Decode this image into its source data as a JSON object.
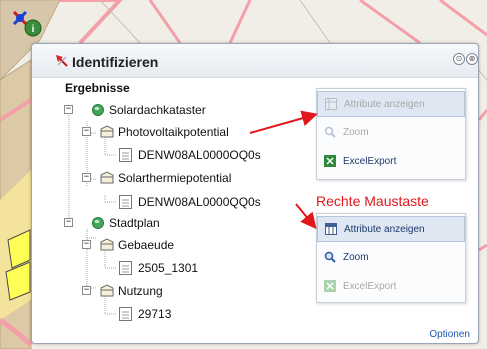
{
  "panel": {
    "title": "Identifizieren",
    "title_icon": "pin-icon",
    "minimize_glyph": "⊙",
    "close_glyph": "⊗",
    "section_label": "Ergebnisse",
    "footer_link": "Optionen"
  },
  "tree": {
    "groups": [
      {
        "label": "Solardachkataster",
        "expander": "−",
        "layers": [
          {
            "label": "Photovoltaikpotential",
            "expander": "−",
            "features": [
              "DENW08AL0000OQ0s"
            ]
          },
          {
            "label": "Solarthermiepotential",
            "expander": "−",
            "features": [
              "DENW08AL0000QQ0s"
            ]
          }
        ]
      },
      {
        "label": "Stadtplan",
        "expander": "−",
        "layers": [
          {
            "label": "Gebaeude",
            "expander": "−",
            "features": [
              "2505_1301"
            ]
          },
          {
            "label": "Nutzung",
            "expander": "−",
            "features": [
              "29713"
            ]
          }
        ]
      }
    ]
  },
  "context_menu_left_click": {
    "items": [
      {
        "label": "Attribute anzeigen",
        "icon": "table-icon",
        "state": "disabled"
      },
      {
        "label": "Zoom",
        "icon": "zoom-icon",
        "state": "disabled"
      },
      {
        "label": "ExcelExport",
        "icon": "excel-icon",
        "state": "enabled"
      }
    ]
  },
  "context_menu_right_click": {
    "items": [
      {
        "label": "Attribute anzeigen",
        "icon": "table-icon",
        "state": "enabled"
      },
      {
        "label": "Zoom",
        "icon": "zoom-icon",
        "state": "enabled"
      },
      {
        "label": "ExcelExport",
        "icon": "excel-icon",
        "state": "disabled"
      }
    ]
  },
  "annotation": {
    "text": "Rechte Maustaste",
    "color": "#e2171b"
  },
  "colors": {
    "accent": "#1f57b0",
    "map_road": "#f4a0a8",
    "map_building": "#ffff55",
    "map_block": "#d9b88a"
  }
}
